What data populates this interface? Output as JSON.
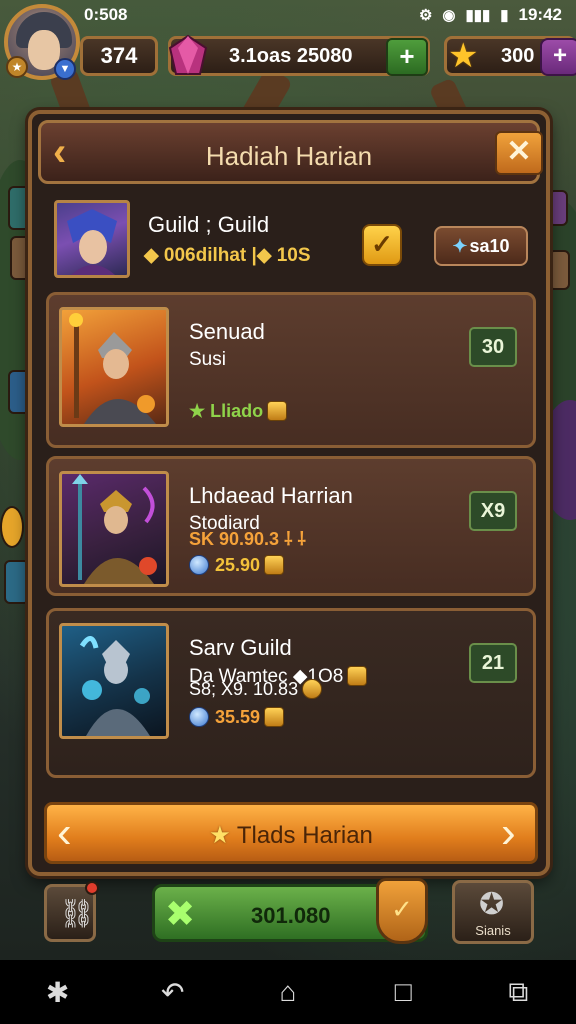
{
  "status_bar": {
    "left_time": "0:508",
    "right_time": "19:42",
    "icons": [
      "settings-icon",
      "wifi-icon",
      "signal-icon",
      "battery-icon"
    ]
  },
  "hud": {
    "level": "374",
    "gems_label": "3.1oas 25080",
    "gems_plus": "+",
    "stars": "300",
    "stars_plus": "+"
  },
  "dialog": {
    "title": "Hadiah Harian",
    "back_glyph": "‹",
    "close_glyph": "✕",
    "guild": {
      "name": "Guild ; Guild",
      "sub": "◆ 006dilhat  |◆ 10S",
      "check": "✓",
      "cost": "sa10",
      "cost_icon": "✦"
    },
    "cards": [
      {
        "title": "Senuad",
        "sub": "Susi",
        "line1": "★ Lliado",
        "badge": "30"
      },
      {
        "title": "Lhdaead Harrian",
        "sub": "Stodiard",
        "line1": "SK 90.90.3  ⸸ ⸸",
        "line2": "25.90",
        "badge": "X9"
      },
      {
        "title": "Sarv Guild",
        "sub": "Da Wamtec  ◆1O8",
        "line1": "S8; X9. 10.83",
        "line2": "35.59",
        "badge": "21"
      }
    ],
    "banner": {
      "label": "Tlads Harian",
      "star": "★",
      "left_arrow": "‹",
      "right_arrow": "›"
    }
  },
  "bottom": {
    "main_value": "301.080",
    "main_glyph": "✖",
    "shield_glyph": "✓",
    "right_label": "Sianis",
    "left_glyph": "⛓",
    "right_glyph": "✪"
  },
  "nav": {
    "items": [
      "✱",
      "↶",
      "⌂",
      "□",
      "⧉"
    ]
  }
}
